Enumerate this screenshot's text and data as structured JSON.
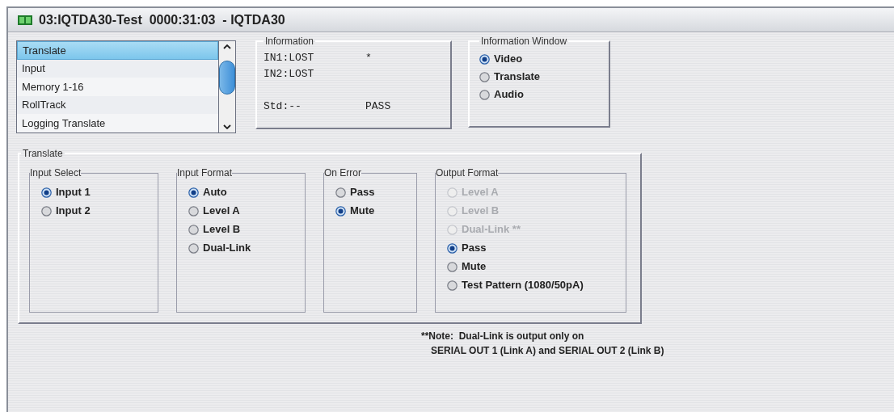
{
  "window": {
    "title": "03:IQTDA30-Test  0000:31:03  - IQTDA30"
  },
  "menu_list": {
    "items": [
      {
        "label": "Translate",
        "selected": true
      },
      {
        "label": "Input",
        "selected": false
      },
      {
        "label": "Memory 1-16",
        "selected": false
      },
      {
        "label": "RollTrack",
        "selected": false
      },
      {
        "label": "Logging Translate",
        "selected": false
      }
    ]
  },
  "information": {
    "title": "Information",
    "lines": [
      {
        "left": "IN1:LOST",
        "right": "*"
      },
      {
        "left": "IN2:LOST"
      }
    ],
    "standard": {
      "left": "Std:--",
      "right": "PASS"
    }
  },
  "information_window": {
    "title": "Information Window",
    "options": [
      {
        "label": "Video",
        "selected": true,
        "disabled": false
      },
      {
        "label": "Translate",
        "selected": false,
        "disabled": false
      },
      {
        "label": "Audio",
        "selected": false,
        "disabled": false
      }
    ]
  },
  "translate": {
    "title": "Translate",
    "groups": [
      {
        "title": "Input Select",
        "options": [
          {
            "label": "Input 1",
            "selected": true,
            "disabled": false
          },
          {
            "label": "Input 2",
            "selected": false,
            "disabled": false
          }
        ]
      },
      {
        "title": "Input Format",
        "options": [
          {
            "label": "Auto",
            "selected": true,
            "disabled": false
          },
          {
            "label": "Level A",
            "selected": false,
            "disabled": false
          },
          {
            "label": "Level B",
            "selected": false,
            "disabled": false
          },
          {
            "label": "Dual-Link",
            "selected": false,
            "disabled": false
          }
        ]
      },
      {
        "title": "On Error",
        "options": [
          {
            "label": "Pass",
            "selected": false,
            "disabled": false
          },
          {
            "label": "Mute",
            "selected": true,
            "disabled": false
          }
        ]
      },
      {
        "title": "Output Format",
        "options": [
          {
            "label": "Level A",
            "selected": false,
            "disabled": true
          },
          {
            "label": "Level B",
            "selected": false,
            "disabled": true
          },
          {
            "label": "Dual-Link **",
            "selected": false,
            "disabled": true
          },
          {
            "label": "Pass",
            "selected": true,
            "disabled": false
          },
          {
            "label": "Mute",
            "selected": false,
            "disabled": false
          },
          {
            "label": "Test Pattern (1080/50pA)",
            "selected": false,
            "disabled": false
          }
        ]
      }
    ]
  },
  "note": [
    "**Note:  Dual-Link is output only on",
    "SERIAL OUT 1 (Link A) and SERIAL OUT 2 (Link B)"
  ]
}
